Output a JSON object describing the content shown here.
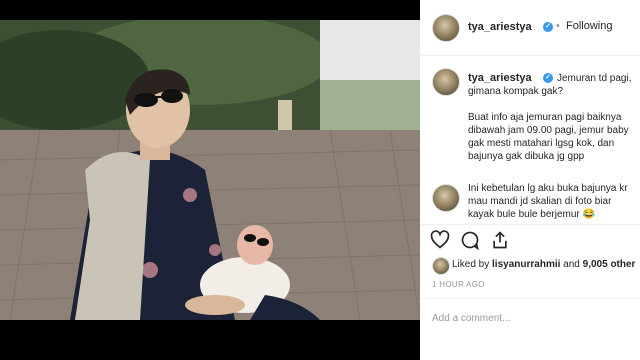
{
  "post": {
    "username": "tya_ariestya",
    "follow_separator": "•",
    "follow_label": "Following",
    "caption_line1": "Jemuran td pagi,",
    "caption_line2": "gimana kompak gak?",
    "paragraph2": "Buat info aja jemuran pagi baiknya\ndibawah jam 09.00 pagi, jemur baby\ngak mesti matahari lgsg kok, dan\nbajunya gak dibuka jg gpp",
    "comment_text": "Ini kebetulan lg aku buka bajunya kr\nmau mandi jd skalian di foto biar\nkayak bule bule berjemur 😂",
    "liked_prefix": "Liked by",
    "liked_user": "lisyanurrahmii",
    "liked_mid": "and",
    "liked_count": "9,005 other",
    "time_ago": "1 HOUR AGO",
    "add_comment_placeholder": "Add a comment..."
  },
  "icons": {
    "like": "heart-icon",
    "comment": "comment-bubble-icon",
    "share": "share-icon",
    "verified": "verified-badge-icon"
  },
  "colors": {
    "verified_blue": "#3897f0",
    "meta_gray": "#999999",
    "text": "#262626",
    "divider": "#efefef"
  }
}
